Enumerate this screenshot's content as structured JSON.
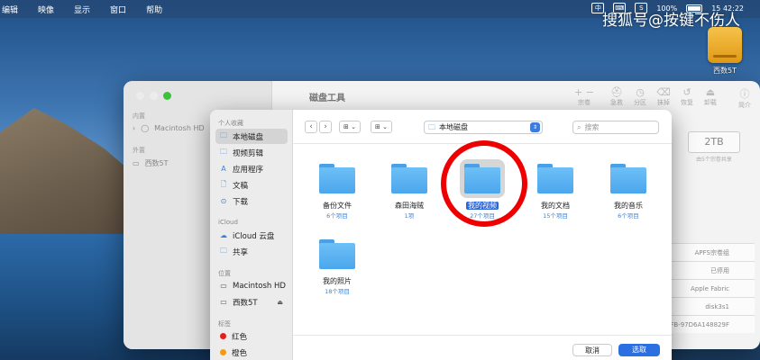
{
  "menubar": {
    "items": [
      "编辑",
      "映像",
      "显示",
      "窗口",
      "帮助"
    ],
    "status_icons": [
      "中",
      "⌨",
      "S"
    ],
    "battery": "100%",
    "clock": "15 42:22"
  },
  "watermark": "搜狐号@按键不伤人",
  "desktop_disk": {
    "label": "西数5T"
  },
  "disk_utility": {
    "title": "磁盘工具",
    "sidebar_sections": [
      "内置",
      "外置"
    ],
    "sidebar_items": [
      "Macintosh HD",
      "西数5T"
    ],
    "toolbar": [
      "宗卷",
      "急救",
      "分区",
      "抹掉",
      "恢复",
      "卸载",
      "简介"
    ],
    "capacity": "2TB",
    "capacity_sub": "由5个宗卷共享",
    "info": [
      "APFS宗卷组",
      "已停用",
      "Apple Fabric",
      "disk3s1",
      "4FB-97D6A148829F"
    ]
  },
  "dialog": {
    "sidebar": {
      "favorites_header": "个人收藏",
      "favorites": [
        {
          "icon": "🗀",
          "label": "本地磁盘"
        },
        {
          "icon": "🗀",
          "label": "视频剪辑"
        },
        {
          "icon": "A",
          "label": "应用程序"
        },
        {
          "icon": "🗋",
          "label": "文稿"
        },
        {
          "icon": "⊙",
          "label": "下载"
        }
      ],
      "icloud_header": "iCloud",
      "icloud": [
        {
          "icon": "☁",
          "label": "iCloud 云盘"
        },
        {
          "icon": "🗀",
          "label": "共享"
        }
      ],
      "locations_header": "位置",
      "locations": [
        {
          "icon": "▭",
          "label": "Macintosh HD"
        },
        {
          "icon": "▭",
          "label": "西数5T"
        }
      ],
      "tags_header": "标签",
      "tags": [
        {
          "label": "红色",
          "color": "#e02020"
        },
        {
          "label": "橙色",
          "color": "#f29a1a"
        }
      ]
    },
    "toolbar": {
      "location": "本地磁盘",
      "search_placeholder": "搜索",
      "view_icon": "⊞",
      "group_icon": "⊞"
    },
    "files": [
      {
        "name": "备份文件",
        "count": "6个项目"
      },
      {
        "name": "森田海贼",
        "count": "1项"
      },
      {
        "name": "我的视频",
        "count": "27个项目"
      },
      {
        "name": "我的文档",
        "count": "15个项目"
      },
      {
        "name": "我的音乐",
        "count": "6个项目"
      },
      {
        "name": "我的照片",
        "count": "18个项目"
      }
    ],
    "buttons": {
      "cancel": "取消",
      "choose": "选取"
    }
  }
}
